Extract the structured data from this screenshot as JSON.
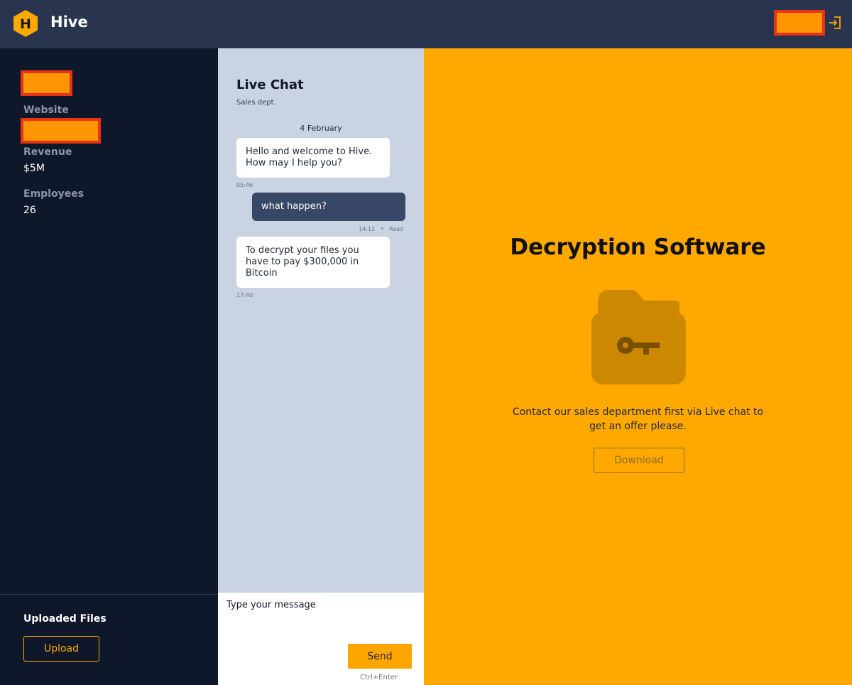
{
  "header": {
    "brand": "Hive",
    "logo_letter": "H",
    "logo_icon": "hexagon-logo",
    "logout_icon": "logout-icon"
  },
  "sidebar": {
    "website_label": "Website",
    "revenue_label": "Revenue",
    "revenue_value": "$5M",
    "employees_label": "Employees",
    "employees_value": "26",
    "uploaded_title": "Uploaded Files",
    "upload_label": "Upload"
  },
  "chat": {
    "title": "Live Chat",
    "subtitle": "Sales dept.",
    "date": "4 February",
    "messages": [
      {
        "direction": "in",
        "text": "Hello and welcome to Hive. How may I help you?",
        "time": "05:46"
      },
      {
        "direction": "out",
        "text": "what happen?",
        "time": "14:12",
        "status": "Read"
      },
      {
        "direction": "in",
        "text": "To decrypt your files you have to pay $300,000 in Bitcoin",
        "time": "17:40"
      }
    ],
    "composer": {
      "placeholder": "Type your message",
      "send_label": "Send",
      "shortcut": "Ctrl+Enter"
    }
  },
  "panel": {
    "title": "Decryption Software",
    "icon": "folder-key-icon",
    "description": "Contact our sales department first via Live chat to get an offer please.",
    "download_label": "Download"
  },
  "colors": {
    "header_bg": "#29354f",
    "sidebar_bg": "#0f172a",
    "chat_bg": "#c9d3e1",
    "accent": "#ffa800",
    "outgoing_bubble": "#374766",
    "redaction_fill": "#ff9500",
    "redaction_border": "#e8321a"
  }
}
